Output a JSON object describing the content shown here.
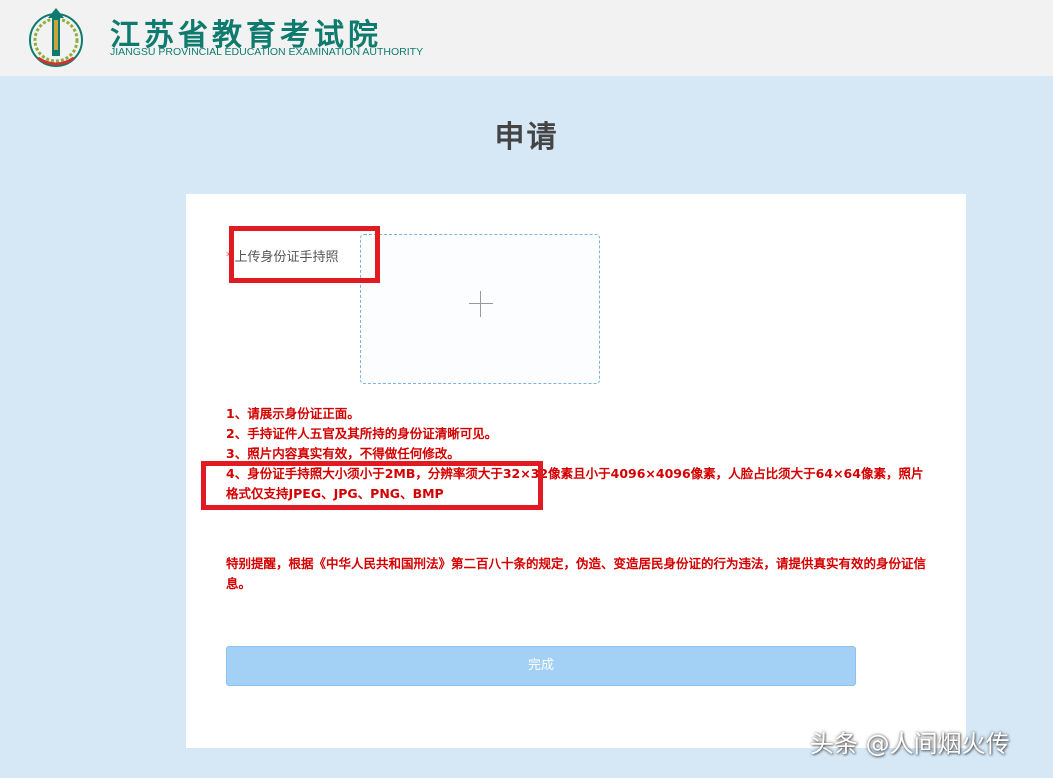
{
  "header": {
    "logo_name_cn": "江苏省教育考试院",
    "logo_name_en": "JIANGSU PROVINCIAL EDUCATION EXAMINATION AUTHORITY",
    "brand_color": "#0e7b6e"
  },
  "page": {
    "title": "申请"
  },
  "upload": {
    "required_mark": "*",
    "label": "上传身份证手持照",
    "icon": "plus-icon"
  },
  "notes": [
    "1、请展示身份证正面。",
    "2、手持证件人五官及其所持的身份证清晰可见。",
    "3、照片内容真实有效，不得做任何修改。",
    "4、身份证手持照大小须小于2MB，分辨率须大于32×32像素且小于4096×4096像素，人脸占比须大于64×64像素，照片格式仅支持JPEG、JPG、PNG、BMP"
  ],
  "warning": "特别提醒，根据《中华人民共和国刑法》第二百八十条的规定，伪造、变造居民身份证的行为违法，请提供真实有效的身份证信息。",
  "submit_label": "完成",
  "colors": {
    "background": "#d6e8f6",
    "notice_red": "#d40000",
    "button": "#a3d0f5",
    "annotation_red": "#e21a22"
  },
  "watermark": "头条 @人间烟火传"
}
